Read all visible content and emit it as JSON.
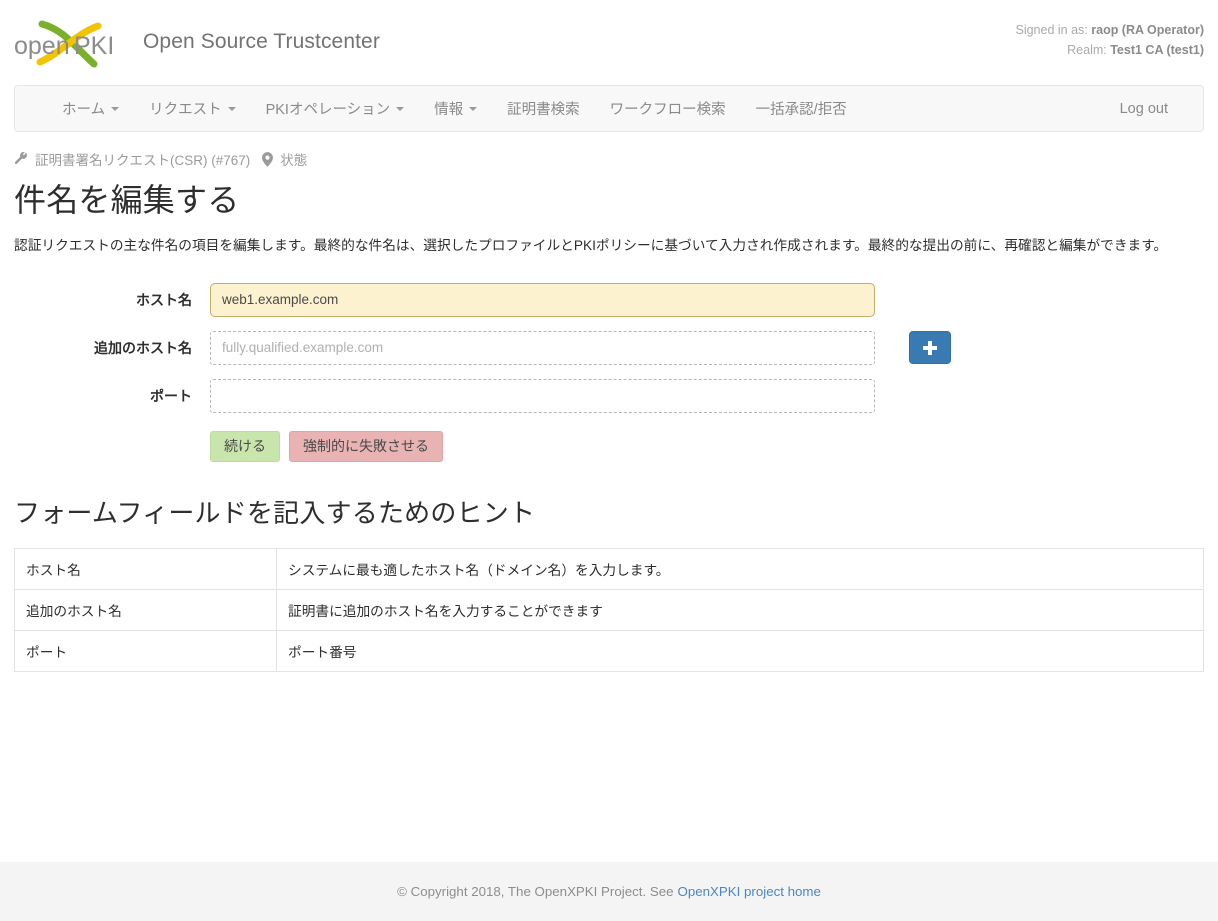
{
  "header": {
    "logo_alt": "openXPKI",
    "logo_text_left": "open",
    "logo_text_right": "PKI",
    "brand_title": "Open Source Trustcenter",
    "signed_in_label": "Signed in as:",
    "signed_in_value": "raop (RA Operator)",
    "realm_label": "Realm:",
    "realm_value": "Test1 CA (test1)",
    "colors": {
      "logo_green": "#7bb02d",
      "logo_yellow": "#f2c400",
      "logo_gray": "#8c8c8c"
    }
  },
  "nav": {
    "items": [
      {
        "label": "ホーム",
        "has_caret": true
      },
      {
        "label": "リクエスト",
        "has_caret": true
      },
      {
        "label": "PKIオペレーション",
        "has_caret": true
      },
      {
        "label": "情報",
        "has_caret": true
      },
      {
        "label": "証明書検索",
        "has_caret": false
      },
      {
        "label": "ワークフロー検索",
        "has_caret": false
      },
      {
        "label": "一括承認/拒否",
        "has_caret": false
      }
    ],
    "logout_label": "Log out"
  },
  "breadcrumb": {
    "items": [
      {
        "icon": "wrench-icon",
        "label": "証明書署名リクエスト(CSR) (#767)"
      },
      {
        "icon": "map-marker-icon",
        "label": "状態"
      }
    ]
  },
  "page": {
    "title": "件名を編集する",
    "description": "認証リクエストの主な件名の項目を編集します。最終的な件名は、選択したプロファイルとPKIポリシーに基づいて入力され作成されます。最終的な提出の前に、再確認と編集ができます。"
  },
  "form": {
    "fields": [
      {
        "label": "ホスト名",
        "value": "web1.example.com",
        "placeholder": "",
        "style": "filled",
        "has_add_button": false
      },
      {
        "label": "追加のホスト名",
        "value": "",
        "placeholder": "fully.qualified.example.com",
        "style": "dashed",
        "has_add_button": true
      },
      {
        "label": "ポート",
        "value": "",
        "placeholder": "",
        "style": "dashed",
        "has_add_button": false
      }
    ],
    "add_button_icon": "plus-icon",
    "submit_label": "続ける",
    "fail_label": "強制的に失敗させる",
    "colors": {
      "submit_bg": "#c8e5ac",
      "fail_bg": "#e9b3b3",
      "add_bg": "#3a7ab2",
      "filled_bg": "#fdf2cf",
      "filled_border": "#c4ad64"
    }
  },
  "hints": {
    "title": "フォームフィールドを記入するためのヒント",
    "rows": [
      {
        "key": "ホスト名",
        "value": "システムに最も適したホスト名（ドメイン名）を入力します。"
      },
      {
        "key": "追加のホスト名",
        "value": "証明書に追加のホスト名を入力することができます"
      },
      {
        "key": "ポート",
        "value": "ポート番号"
      }
    ]
  },
  "footer": {
    "text": "© Copyright 2018, The OpenXPKI Project. See",
    "link_label": "OpenXPKI project home",
    "link_color": "#4a87c4"
  }
}
